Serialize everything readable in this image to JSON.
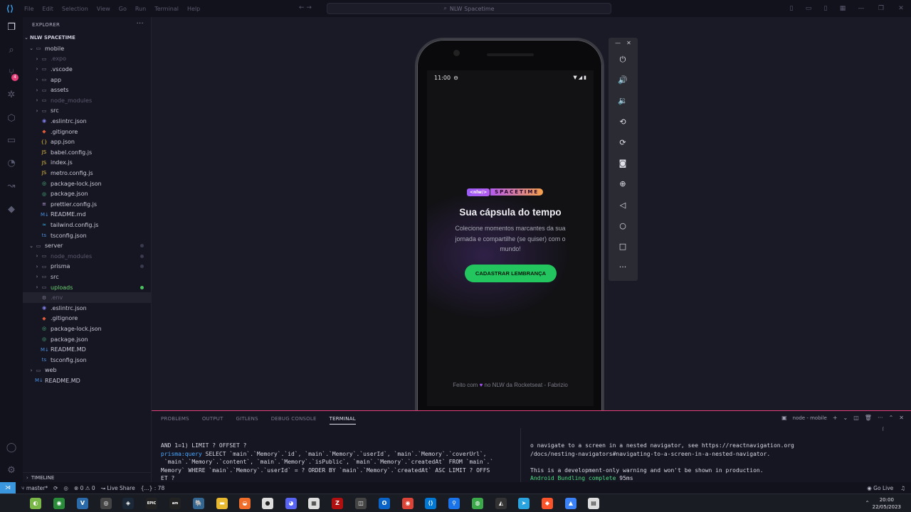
{
  "titlebar": {
    "menu": [
      "File",
      "Edit",
      "Selection",
      "View",
      "Go",
      "Run",
      "Terminal",
      "Help"
    ],
    "search": "NLW Spacetime",
    "nav": "←  →"
  },
  "activity": {
    "scm_badge": "4"
  },
  "explorer": {
    "header": "EXPLORER",
    "root": "NLW SPACETIME",
    "timeline": "TIMELINE",
    "items": [
      {
        "label": "mobile",
        "depth": 1,
        "type": "folder-open",
        "dim": false
      },
      {
        "label": ".expo",
        "depth": 2,
        "type": "folder",
        "dim": true
      },
      {
        "label": ".vscode",
        "depth": 2,
        "type": "folder",
        "dim": false
      },
      {
        "label": "app",
        "depth": 2,
        "type": "folder",
        "dim": false
      },
      {
        "label": "assets",
        "depth": 2,
        "type": "folder",
        "dim": false
      },
      {
        "label": "node_modules",
        "depth": 2,
        "type": "folder",
        "dim": true
      },
      {
        "label": "src",
        "depth": 2,
        "type": "folder",
        "dim": false
      },
      {
        "label": ".eslintrc.json",
        "depth": 2,
        "type": "eslint",
        "dim": false
      },
      {
        "label": ".gitignore",
        "depth": 2,
        "type": "git",
        "dim": false
      },
      {
        "label": "app.json",
        "depth": 2,
        "type": "json",
        "dim": false
      },
      {
        "label": "babel.config.js",
        "depth": 2,
        "type": "js",
        "dim": false
      },
      {
        "label": "index.js",
        "depth": 2,
        "type": "js",
        "dim": false
      },
      {
        "label": "metro.config.js",
        "depth": 2,
        "type": "js",
        "dim": false
      },
      {
        "label": "package-lock.json",
        "depth": 2,
        "type": "npm",
        "dim": false
      },
      {
        "label": "package.json",
        "depth": 2,
        "type": "npm",
        "dim": false
      },
      {
        "label": "prettier.config.js",
        "depth": 2,
        "type": "prettier",
        "dim": false
      },
      {
        "label": "README.md",
        "depth": 2,
        "type": "md",
        "dim": false
      },
      {
        "label": "tailwind.config.js",
        "depth": 2,
        "type": "tailwind",
        "dim": false
      },
      {
        "label": "tsconfig.json",
        "depth": 2,
        "type": "ts",
        "dim": false
      },
      {
        "label": "server",
        "depth": 1,
        "type": "folder-open",
        "dim": false
      },
      {
        "label": "node_modules",
        "depth": 2,
        "type": "folder",
        "dim": true
      },
      {
        "label": "prisma",
        "depth": 2,
        "type": "folder",
        "dim": false
      },
      {
        "label": "src",
        "depth": 2,
        "type": "folder",
        "dim": false
      },
      {
        "label": "uploads",
        "depth": 2,
        "type": "folder",
        "dim": false
      },
      {
        "label": ".env",
        "depth": 2,
        "type": "env",
        "dim": true
      },
      {
        "label": ".eslintrc.json",
        "depth": 2,
        "type": "eslint",
        "dim": false
      },
      {
        "label": ".gitignore",
        "depth": 2,
        "type": "git",
        "dim": false
      },
      {
        "label": "package-lock.json",
        "depth": 2,
        "type": "npm",
        "dim": false
      },
      {
        "label": "package.json",
        "depth": 2,
        "type": "npm",
        "dim": false
      },
      {
        "label": "README.MD",
        "depth": 2,
        "type": "md",
        "dim": false
      },
      {
        "label": "tsconfig.json",
        "depth": 2,
        "type": "ts",
        "dim": false
      },
      {
        "label": "web",
        "depth": 1,
        "type": "folder",
        "dim": false
      },
      {
        "label": "README.MD",
        "depth": 1,
        "type": "md",
        "dim": false
      }
    ]
  },
  "phone": {
    "time": "11:00",
    "logo_left": "<nlw/>",
    "logo_right": "SPACETIME",
    "title": "Sua cápsula do tempo",
    "subtitle": "Colecione momentos marcantes da sua jornada e compartilhe (se quiser) com o mundo!",
    "cta": "CADASTRAR LEMBRANÇA",
    "footer_before": "Feito com",
    "footer_after": "no NLW da Rocketseat - Fabrizio"
  },
  "panel": {
    "tabs": [
      "PROBLEMS",
      "OUTPUT",
      "GITLENS",
      "DEBUG CONSOLE",
      "TERMINAL"
    ],
    "terminal_name": "node - mobile",
    "left_lines": [
      "AND 1=1) LIMIT ? OFFSET ?",
      "SELECT `main`.`Memory`.`id`, `main`.`Memory`.`userId`, `main`.`Memory`.`coverUrl`,",
      " `main`.`Memory`.`content`, `main`.`Memory`.`isPublic`, `main`.`Memory`.`createdAt` FROM `main`.`",
      "Memory` WHERE `main`.`Memory`.`userId` = ? ORDER BY `main`.`Memory`.`createdAt` ASC LIMIT ? OFFS",
      "ET ?"
    ],
    "left_prefix": "prisma:query",
    "right_lines": [
      "o navigate to a screen in a nested navigator, see https://reactnavigation.org",
      "/docs/nesting-navigators#navigating-to-a-screen-in-a-nested-navigator.",
      "",
      "This is a development-only warning and won't be shown in production."
    ],
    "bundling": "Android Bundling complete",
    "bundling_time": "95ms"
  },
  "statusbar": {
    "branch": "master*",
    "errors": "0",
    "warnings": "0",
    "live_share": "Live Share",
    "position": "{...} : 78",
    "go_live": "Go Live"
  },
  "taskbar": {
    "time": "20:00",
    "date": "22/05/2023"
  },
  "colors": {
    "accent_pink": "#e5407a",
    "cta_green": "#22c55e",
    "vscode_blue": "#3a96dd"
  }
}
